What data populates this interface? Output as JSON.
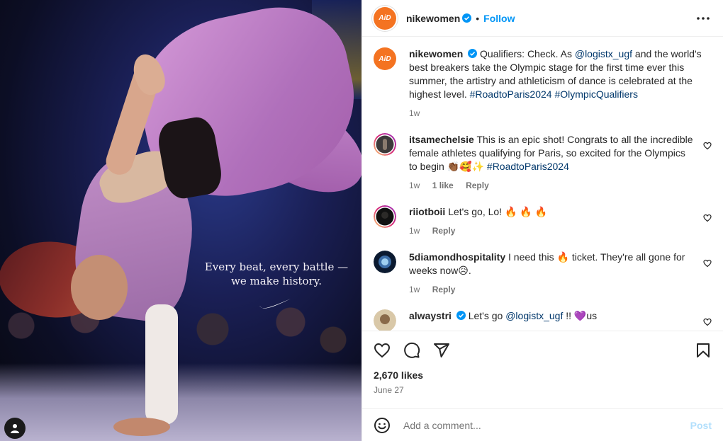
{
  "post": {
    "author": "nikewomen",
    "avatar_text": "AiD",
    "follow_label": "Follow",
    "separator": "•",
    "media": {
      "tagline_line1": "Every beat, every battle —",
      "tagline_line2": "we make history."
    },
    "caption": {
      "author": "nikewomen",
      "text": "Qualifiers: Check. As ",
      "mention": "@logistx_ugf",
      "text2": " and the world's best breakers take the Olympic stage for the first time ever this summer, the artistry and athleticism of dance is celebrated at the highest level. ",
      "hashtags": "#RoadtoParis2024 #OlympicQualifiers",
      "time": "1w"
    },
    "comments": [
      {
        "user": "itsamechelsie",
        "text": "This is an epic shot! Congrats to all the incredible female athletes qualifying for Paris, so excited for the Olympics to begin 👏🏾🥰✨ ",
        "hashtag": "#RoadtoParis2024",
        "time": "1w",
        "likes": "1 like",
        "reply": "Reply"
      },
      {
        "user": "riiotboii",
        "text": "Let's go, Lo! 🔥 🔥 🔥",
        "time": "1w",
        "reply": "Reply"
      },
      {
        "user": "5diamondhospitality",
        "text": "I need this 🔥 ticket. They're all gone for weeks now😥.",
        "time": "1w",
        "reply": "Reply"
      },
      {
        "user": "alwaystri",
        "text": "Let's go ",
        "mention": "@logistx_ugf",
        "text2": " !! 💜us"
      }
    ],
    "likes": "2,670 likes",
    "date": "June 27",
    "add_comment_placeholder": "Add a comment...",
    "post_label": "Post"
  },
  "colors": {
    "accent": "#0095f6",
    "brand_avatar": "#f47321",
    "link": "#00376b"
  },
  "icons": [
    "verified-badge-icon",
    "more-options-icon",
    "heart-icon",
    "comment-icon",
    "share-icon",
    "bookmark-icon",
    "emoji-icon",
    "user-tag-icon",
    "swoosh-logo"
  ]
}
